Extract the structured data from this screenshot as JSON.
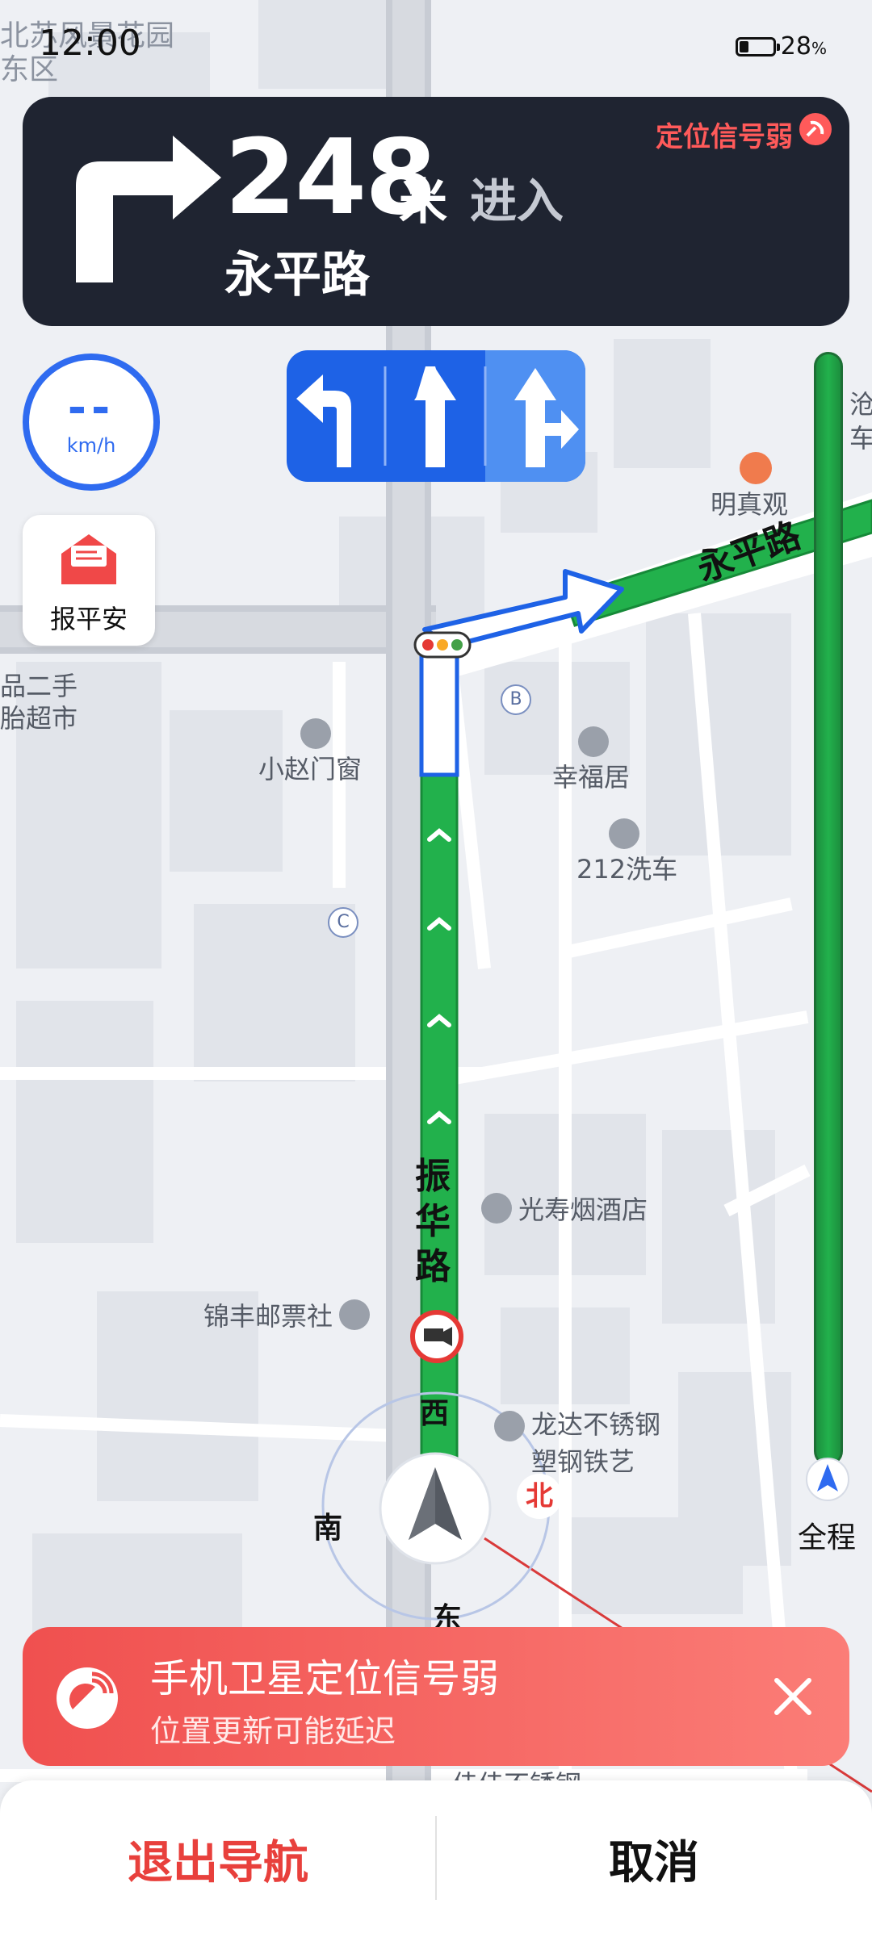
{
  "status_bar": {
    "time": "12:00",
    "battery_percent": "28",
    "battery_unit": "%",
    "battery_level": 0.28
  },
  "navigation": {
    "turn_direction": "right",
    "distance": "248",
    "distance_unit": "米",
    "action": "进入",
    "road": "永平路",
    "gps_status": "定位信号弱"
  },
  "speed": {
    "value": "--",
    "unit": "km/h"
  },
  "lanes": [
    {
      "arrow": "left",
      "recommended": false
    },
    {
      "arrow": "straight",
      "recommended": false
    },
    {
      "arrow": "straight-right",
      "recommended": true
    }
  ],
  "safety_button": {
    "label": "报平安"
  },
  "progress": {
    "label": "全程"
  },
  "map": {
    "area_label": "北苏风景花园东区",
    "current_road": "振华路",
    "next_road": "永平路",
    "pois": [
      {
        "name": "明真观",
        "icon": "temple-icon"
      },
      {
        "name": "小赵门窗",
        "icon": "shop-icon"
      },
      {
        "name": "幸福居",
        "icon": "home-icon"
      },
      {
        "name": "212洗车",
        "icon": "car-wash-icon"
      },
      {
        "name": "光寿烟酒店",
        "icon": "shop-icon"
      },
      {
        "name": "锦丰邮票社",
        "icon": "shop-icon"
      },
      {
        "name": "龙达不锈钢",
        "icon": "shop-icon"
      },
      {
        "name": "塑钢铁艺",
        "icon": "shop-icon"
      },
      {
        "name": "品二手",
        "icon": "shop-icon"
      },
      {
        "name": "胎超市",
        "icon": "shop-icon"
      },
      {
        "name": "沧",
        "icon": ""
      },
      {
        "name": "车",
        "icon": ""
      },
      {
        "name": "佳佳不锈钢",
        "icon": "shop-icon"
      }
    ],
    "markers": [
      "B",
      "C"
    ],
    "compass": {
      "north": "北",
      "south": "南",
      "east": "东",
      "west": "西"
    }
  },
  "alert": {
    "title": "手机卫星定位信号弱",
    "subtitle": "位置更新可能延迟"
  },
  "bottom": {
    "exit_label": "退出导航",
    "cancel_label": "取消"
  },
  "colors": {
    "route": "#22b14c",
    "card_bg": "#1f2431",
    "lane_bg": "#1e62e6",
    "alert_red": "#f0504f",
    "exit_red": "#e8403c"
  }
}
